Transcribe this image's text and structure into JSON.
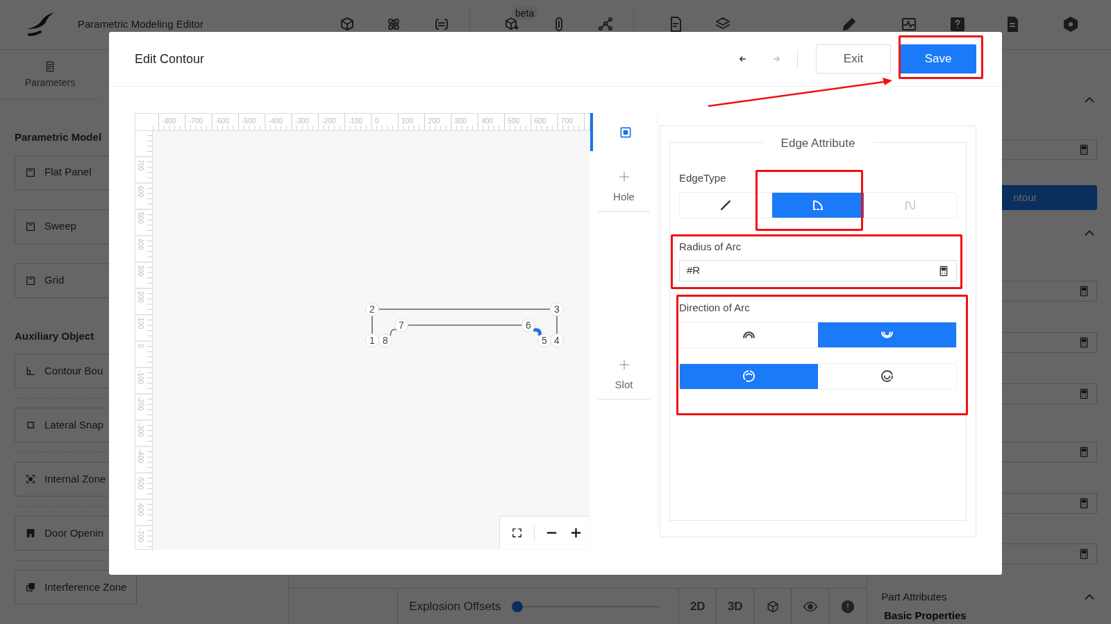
{
  "app": {
    "title": "Parametric Modeling Editor",
    "badge": "beta"
  },
  "left_panel": {
    "tab": "Parameters",
    "sections": [
      {
        "title": "Parametric Model",
        "items": [
          {
            "label": "Flat Panel",
            "kind": "panel"
          },
          {
            "label": "Sweep",
            "kind": "panel"
          },
          {
            "label": "Grid",
            "kind": "panel"
          }
        ]
      },
      {
        "title": "Auxiliary Object",
        "items": [
          {
            "label": "Contour Bou",
            "kind": "contour"
          },
          {
            "label": "Lateral Snap",
            "kind": "snap"
          },
          {
            "label": "Internal Zone",
            "kind": "zone"
          },
          {
            "label": "Door Openin",
            "kind": "door"
          },
          {
            "label": "Interference Zone",
            "kind": "interference"
          }
        ]
      }
    ]
  },
  "right_panel": {
    "button": "ntour",
    "section_title": "Part Attributes",
    "subsection": "Basic Properties"
  },
  "bottom_bar": {
    "slider_label": "Explosion Offsets",
    "slider": {
      "level": 0
    },
    "view_buttons": [
      "2D",
      "3D"
    ]
  },
  "modal": {
    "title": "Edit Contour",
    "exit": "Exit",
    "save": "Save",
    "ruler": {
      "x_labels": [
        "-800",
        "-700",
        "-600",
        "-500",
        "-400",
        "-300",
        "-200",
        "-100",
        "0",
        "100",
        "200",
        "300",
        "400",
        "500",
        "600",
        "700"
      ],
      "y_labels": [
        "700",
        "600",
        "500",
        "400",
        "300",
        "200",
        "100",
        "0",
        "-100",
        "-200",
        "-300",
        "-400",
        "-500",
        "-600",
        "-700"
      ]
    },
    "nodes": [
      {
        "label": "2"
      },
      {
        "label": "3"
      },
      {
        "label": "7"
      },
      {
        "label": "6"
      },
      {
        "label": "1"
      },
      {
        "label": "8"
      },
      {
        "label": "5"
      },
      {
        "label": "4"
      }
    ],
    "edges": [
      {
        "kind": "line",
        "selected": false
      },
      {
        "kind": "line",
        "selected": false
      },
      {
        "kind": "line",
        "selected": false
      },
      {
        "kind": "arc",
        "selected": true
      },
      {
        "kind": "line",
        "selected": false
      },
      {
        "kind": "arc",
        "selected": false
      }
    ],
    "tools": [
      {
        "kind": "select",
        "selected": true
      },
      {
        "kind": "add",
        "label": "Hole",
        "selected": false
      },
      {
        "kind": "add",
        "label": "Slot",
        "selected": false
      }
    ],
    "edge_attribute": {
      "legend": "Edge Attribute",
      "edge_type_label": "EdgeType",
      "edge_types": [
        {
          "kind": "line",
          "selected": false,
          "disabled": false
        },
        {
          "kind": "arc",
          "selected": true,
          "disabled": false
        },
        {
          "kind": "spline",
          "selected": false,
          "disabled": true
        }
      ],
      "radius_label": "Radius of Arc",
      "radius_value": "#R",
      "direction_label": "Direction of Arc",
      "direction_rows": [
        [
          {
            "kind": "convex",
            "selected": false
          },
          {
            "kind": "concave",
            "selected": true
          }
        ],
        [
          {
            "kind": "clockwise",
            "selected": true
          },
          {
            "kind": "counterclockwise",
            "selected": false
          }
        ]
      ]
    }
  }
}
